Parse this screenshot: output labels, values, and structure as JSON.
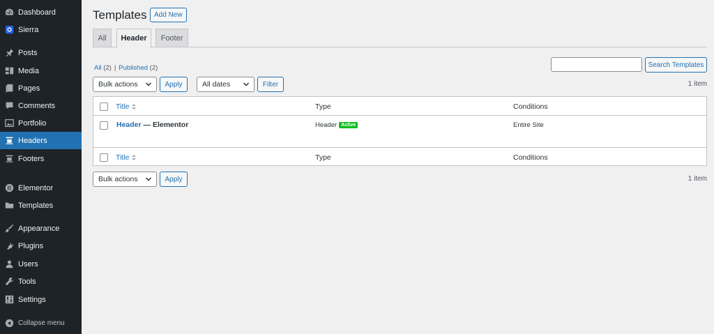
{
  "sidebar": {
    "items": [
      {
        "label": "Dashboard",
        "icon": "dashboard-icon"
      },
      {
        "label": "Sierra",
        "icon": "sierra-icon"
      },
      {
        "label": "Posts",
        "icon": "pin-icon"
      },
      {
        "label": "Media",
        "icon": "media-icon"
      },
      {
        "label": "Pages",
        "icon": "pages-icon"
      },
      {
        "label": "Comments",
        "icon": "comment-icon"
      },
      {
        "label": "Portfolio",
        "icon": "portfolio-icon"
      },
      {
        "label": "Headers",
        "icon": "header-icon"
      },
      {
        "label": "Footers",
        "icon": "footer-icon"
      },
      {
        "label": "Elementor",
        "icon": "elementor-icon"
      },
      {
        "label": "Templates",
        "icon": "folder-icon"
      },
      {
        "label": "Appearance",
        "icon": "brush-icon"
      },
      {
        "label": "Plugins",
        "icon": "plug-icon"
      },
      {
        "label": "Users",
        "icon": "user-icon"
      },
      {
        "label": "Tools",
        "icon": "wrench-icon"
      },
      {
        "label": "Settings",
        "icon": "settings-icon"
      }
    ],
    "active": "Headers",
    "collapse_label": "Collapse menu"
  },
  "page": {
    "title": "Templates",
    "add_new_label": "Add New"
  },
  "tabs": [
    "All",
    "Header",
    "Footer"
  ],
  "active_tab": "Header",
  "filters": {
    "all_label": "All",
    "all_count": "(2)",
    "separator": "|",
    "published_label": "Published",
    "published_count": "(2)"
  },
  "search": {
    "value": "",
    "button_label": "Search Templates"
  },
  "top_nav": {
    "bulk_actions": "Bulk actions",
    "apply_label": "Apply",
    "dates": "All dates",
    "filter_label": "Filter",
    "items_count": "1 item"
  },
  "table": {
    "columns": [
      "Title",
      "Type",
      "Conditions"
    ],
    "rows": [
      {
        "title": "Header",
        "suffix": " — Elementor",
        "type": "Header",
        "badge": "Active",
        "conditions": "Entire Site"
      }
    ]
  },
  "bottom_nav": {
    "bulk_actions": "Bulk actions",
    "apply_label": "Apply",
    "items_count": "1 item"
  },
  "colors": {
    "sidebar_bg": "#1d2327",
    "accent": "#2271b1",
    "active_badge": "#0fbc1e"
  }
}
